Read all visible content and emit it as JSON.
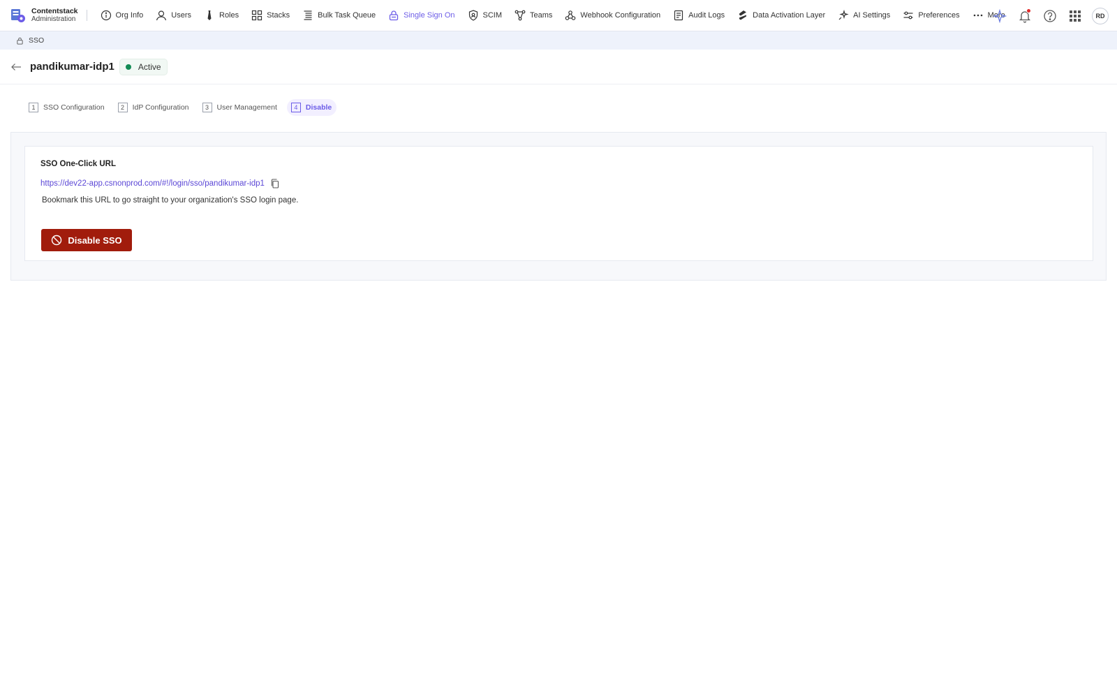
{
  "brand": {
    "name": "Contentstack",
    "subtitle": "Administration"
  },
  "nav": [
    {
      "label": "Org Info",
      "icon": "info-icon"
    },
    {
      "label": "Users",
      "icon": "user-icon"
    },
    {
      "label": "Roles",
      "icon": "tie-icon"
    },
    {
      "label": "Stacks",
      "icon": "grid-icon"
    },
    {
      "label": "Bulk Task Queue",
      "icon": "list-icon"
    },
    {
      "label": "Single Sign On",
      "icon": "lock-icon",
      "active": true
    },
    {
      "label": "SCIM",
      "icon": "shield-icon"
    },
    {
      "label": "Teams",
      "icon": "teams-icon"
    },
    {
      "label": "Webhook Configuration",
      "icon": "webhook-icon"
    },
    {
      "label": "Audit Logs",
      "icon": "audit-icon"
    },
    {
      "label": "Data Activation Layer",
      "icon": "data-layer-icon"
    },
    {
      "label": "AI Settings",
      "icon": "sparkle-icon"
    },
    {
      "label": "Preferences",
      "icon": "sliders-icon"
    },
    {
      "label": "More",
      "icon": "more-icon"
    }
  ],
  "user": {
    "initials": "RD"
  },
  "breadcrumb": {
    "label": "SSO"
  },
  "header": {
    "title": "pandikumar-idp1",
    "status": "Active"
  },
  "steps": [
    {
      "num": "1",
      "label": "SSO Configuration"
    },
    {
      "num": "2",
      "label": "IdP Configuration"
    },
    {
      "num": "3",
      "label": "User Management"
    },
    {
      "num": "4",
      "label": "Disable",
      "active": true
    }
  ],
  "card": {
    "title": "SSO One-Click URL",
    "url": "https://dev22-app.csnonprod.com/#!/login/sso/pandikumar-idp1",
    "helper": "Bookmark this URL to go straight to your organization's SSO login page.",
    "button_label": "Disable SSO"
  },
  "colors": {
    "accent": "#6c5ce7",
    "danger": "#a11c0c",
    "status_active": "#138b55"
  }
}
